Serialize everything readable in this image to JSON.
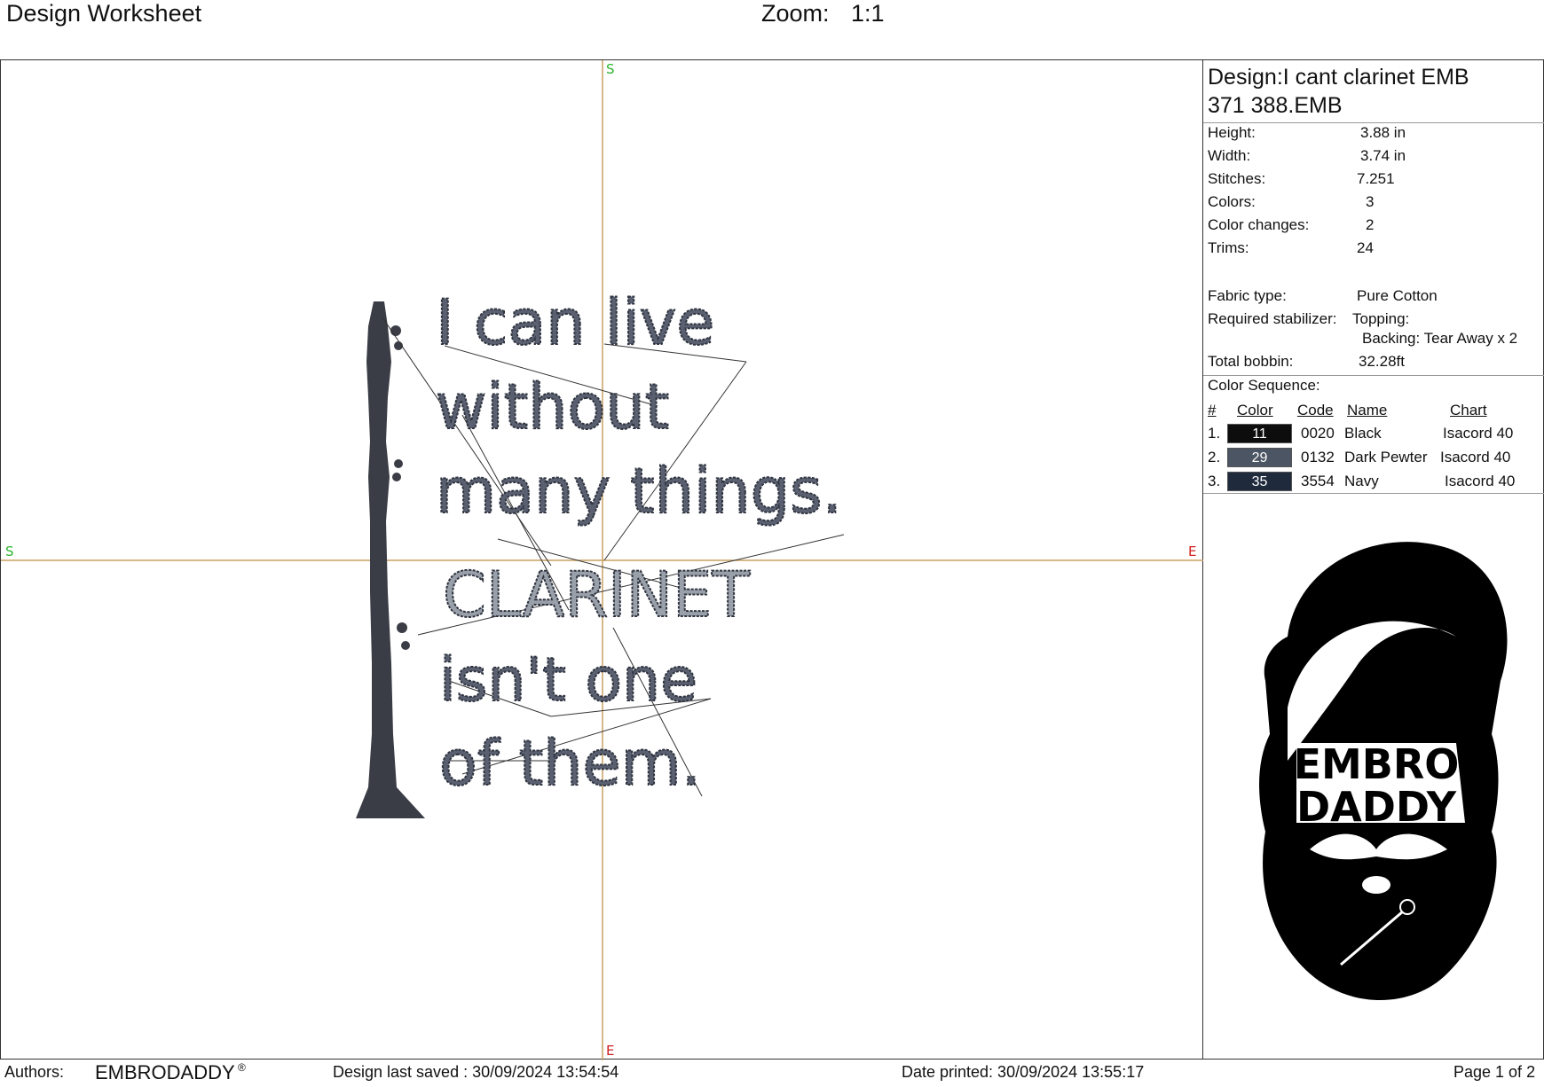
{
  "header": {
    "title": "Design Worksheet",
    "zoom_label": "Zoom:",
    "zoom_value": "1:1"
  },
  "canvas": {
    "axis_marks": {
      "top": "S",
      "left": "S",
      "right": "E",
      "bottom": "E"
    },
    "design_lines": [
      "I can live",
      "without",
      "many things.",
      "CLARINET",
      "isn't one",
      "of them."
    ],
    "thread_color": "#2f3440",
    "guide_color": "#c8a060"
  },
  "info": {
    "design_title": "Design:I cant clarinet EMB",
    "design_file": "371 388.EMB",
    "stats": [
      {
        "label": "Height:",
        "value": "3.88 in"
      },
      {
        "label": "Width:",
        "value": "3.74 in"
      },
      {
        "label": "Stitches:",
        "value": "7.251"
      },
      {
        "label": "Colors:",
        "value": "3"
      },
      {
        "label": "Color changes:",
        "value": "2"
      },
      {
        "label": "Trims:",
        "value": "24"
      }
    ],
    "fabric_label": "Fabric type:",
    "fabric_value": "Pure Cotton",
    "stabilizer_label": "Required stabilizer:",
    "topping_label": "Topping:",
    "backing_value": "Backing: Tear Away x 2",
    "bobbin_label": "Total bobbin:",
    "bobbin_value": "32.28ft",
    "color_sequence_title": "Color Sequence:",
    "seq_headers": {
      "num": "#",
      "color": "Color",
      "code": "Code",
      "name": "Name",
      "chart": "Chart"
    },
    "colors": [
      {
        "num": "1.",
        "swatch": "11",
        "hex": "#0d0d0d",
        "code": "0020",
        "name": "Black",
        "chart": "Isacord 40"
      },
      {
        "num": "2.",
        "swatch": "29",
        "hex": "#4b5563",
        "code": "0132",
        "name": "Dark Pewter",
        "chart": "Isacord 40"
      },
      {
        "num": "3.",
        "swatch": "35",
        "hex": "#1f2a3d",
        "code": "3554",
        "name": "Navy",
        "chart": "Isacord 40"
      }
    ]
  },
  "logo": {
    "line1": "EMBRO",
    "line2": "DADDY"
  },
  "footer": {
    "authors_label": "Authors:",
    "authors_value": "EMBRODADDY",
    "reg_mark": "®",
    "saved": "Design last saved : 30/09/2024 13:54:54",
    "printed": "Date printed: 30/09/2024 13:55:17",
    "page": "Page 1 of 2"
  }
}
